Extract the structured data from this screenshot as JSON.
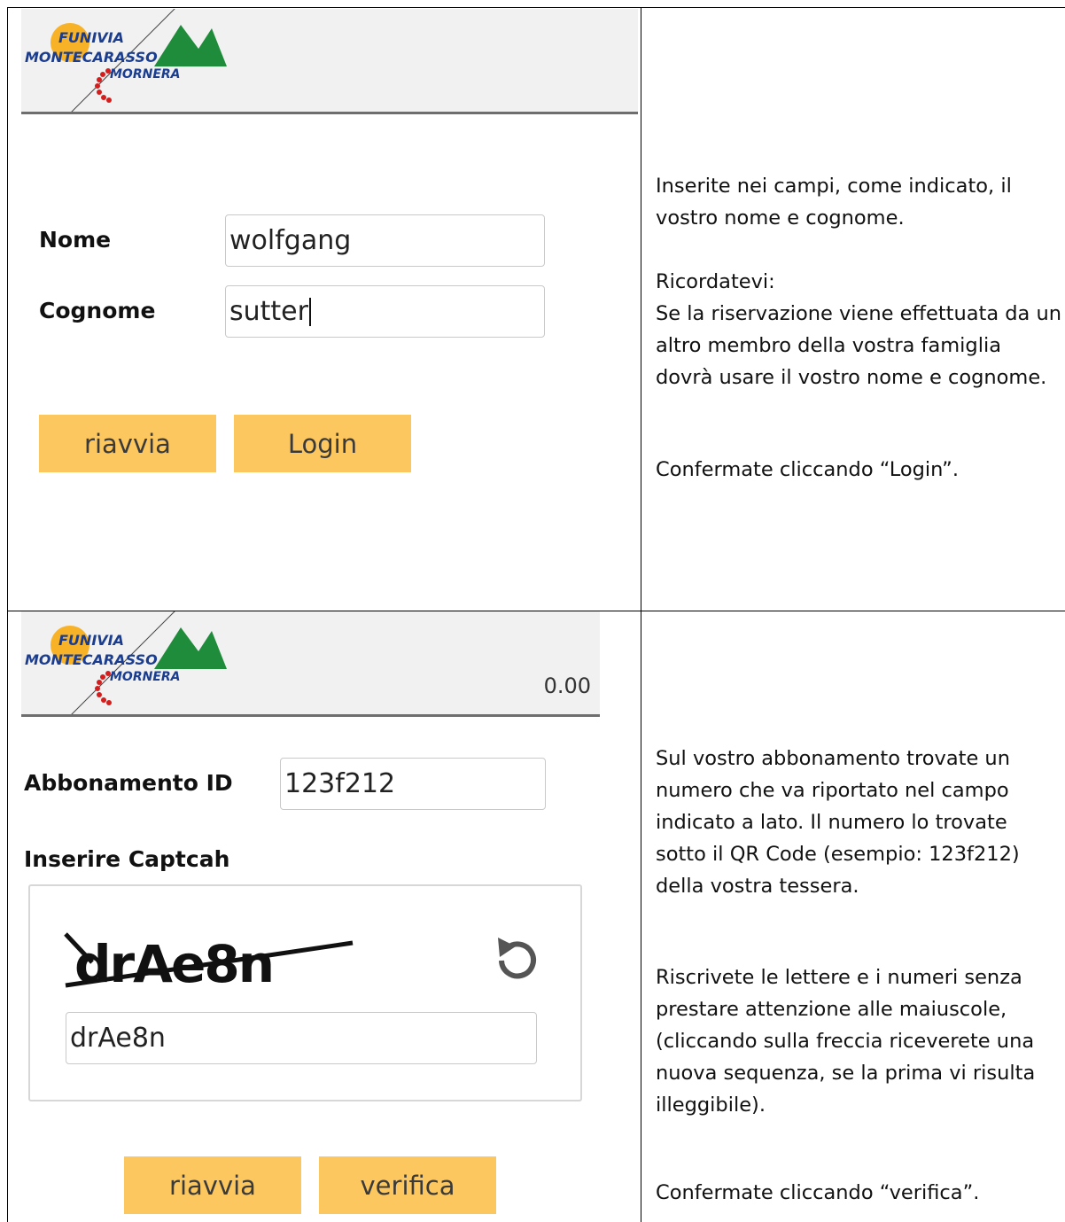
{
  "logo": {
    "line1": "FUNIVIA",
    "line2": "MONTECARASSO",
    "line3": "MORNERA",
    "colors": {
      "sun": "#f7b227",
      "mountain": "#1f8c3b",
      "text_blue": "#1a3d8f",
      "dots": "#d41d1d"
    }
  },
  "step1": {
    "nome_label": "Nome",
    "nome_value": "wolfgang",
    "cognome_label": "Cognome",
    "cognome_value": "sutter",
    "restart_label": "riavvia",
    "login_label": "Login",
    "instructions": {
      "p1": "Inserite nei campi, come indicato, il vostro nome e cognome.",
      "p2": "Ricordatevi:\nSe la riservazione viene effettuata da un altro membro della vostra famiglia dovrà usare il vostro nome e cognome.",
      "p3": "Confermate cliccando “Login”."
    }
  },
  "step2": {
    "amount": "0.00",
    "abbonamento_label": "Abbonamento ID",
    "abbonamento_value": "123f212",
    "captcha_label": "Inserire Captcah",
    "captcha_image_text": "drAe8n",
    "captcha_value": "drAe8n",
    "refresh_icon": "refresh-icon",
    "restart_label": "riavvia",
    "verify_label": "verifica",
    "instructions": {
      "p1": "Sul vostro abbonamento trovate un numero che va riportato nel campo indicato a lato. Il numero lo trovate sotto il QR Code (esempio: 123f212) della vostra tessera.",
      "p2": "Riscrivete le lettere e i numeri senza prestare attenzione alle maiuscole, (cliccando sulla freccia riceverete una nuova sequenza, se la prima vi risulta illeggibile).",
      "p3": "Confermate cliccando “verifica”."
    }
  },
  "colors": {
    "button": "#fcc75f",
    "header_bg": "#f1f1f1",
    "header_line": "#6e6e6e"
  }
}
